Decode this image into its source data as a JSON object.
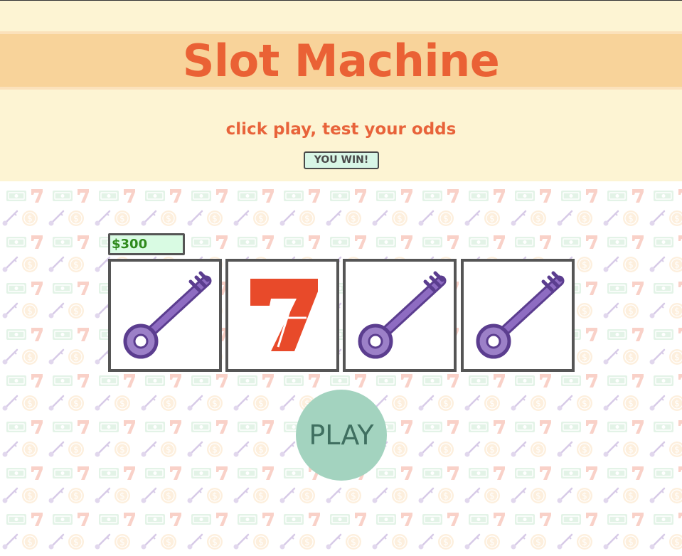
{
  "header": {
    "title": "Slot Machine",
    "subtitle": "click play, test your odds",
    "status": "YOU WIN!"
  },
  "credit": {
    "balance": "$300"
  },
  "reels": [
    {
      "symbol": "key-icon"
    },
    {
      "symbol": "seven-icon"
    },
    {
      "symbol": "key-icon"
    },
    {
      "symbol": "key-icon"
    }
  ],
  "controls": {
    "play_label": "PLAY"
  },
  "background_pattern": {
    "symbols": [
      "cash-icon",
      "seven-icon",
      "key-icon",
      "coin-icon"
    ]
  },
  "colors": {
    "title": "#ea6135",
    "title_band": "#f8d39a",
    "header_bg": "#fdf4d3",
    "key": "#7b4fb0",
    "seven": "#e84a2a",
    "play_button": "#a3d3bf",
    "balance_text": "#2f8a1c"
  }
}
